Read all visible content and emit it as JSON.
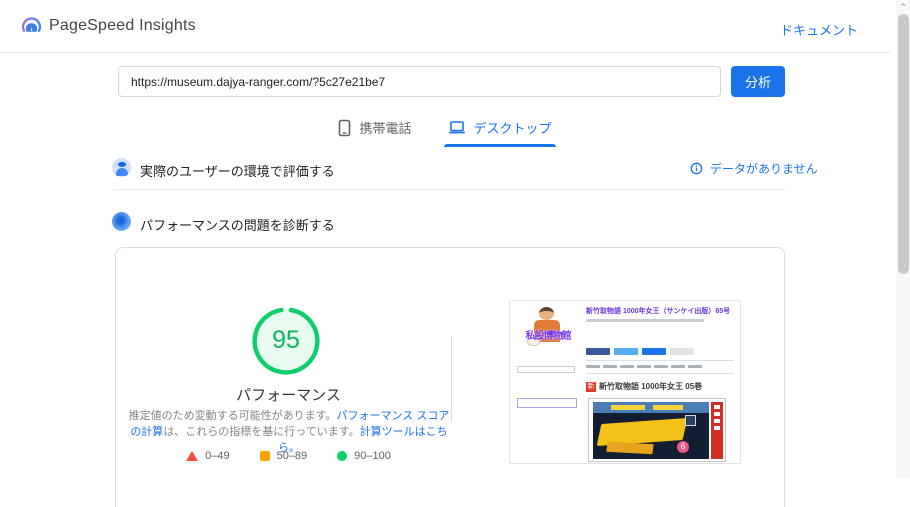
{
  "header": {
    "title": "PageSpeed Insights",
    "doc_link": "ドキュメント"
  },
  "url_bar": {
    "value": "https://museum.dajya-ranger.com/?5c27e21be7",
    "analyze_button": "分析"
  },
  "tabs": [
    {
      "label": "携帯電話",
      "icon": "mobile-phone-icon",
      "active": false
    },
    {
      "label": "デスクトップ",
      "icon": "laptop-icon",
      "active": true
    }
  ],
  "sections": {
    "field_data": {
      "icon": "users-icon",
      "title": "実際のユーザーの環境で評価する",
      "status_icon": "info-icon",
      "status": "データがありません"
    },
    "diagnose": {
      "icon": "speedometer-icon",
      "title": "パフォーマンスの問題を診断する"
    }
  },
  "report": {
    "score": "95",
    "score_label": "パフォーマンス",
    "note_text_1": "推定値のため変動する可能性があります。",
    "note_link_1": "パフォーマンス スコアの計算",
    "note_text_2": "は、これらの指標を基に行っています。",
    "note_link_2": "計算ツールはこちら。",
    "legend": [
      {
        "shape": "triangle",
        "color": "#ff4e42",
        "range": "0–49"
      },
      {
        "shape": "square",
        "color": "#ffa400",
        "range": "50–89"
      },
      {
        "shape": "circle",
        "color": "#0cce6b",
        "range": "90–100"
      }
    ]
  },
  "thumbnail": {
    "site_title": "私設博物館",
    "post_title": "新竹取物語 1000年女王（サンケイ出版）65号",
    "post_heading": "新竹取物語 1000年女王 05巻",
    "cover_badge": "6",
    "new_badge": "新"
  },
  "scrollbar": {
    "up_arrow": "⌃"
  },
  "colors": {
    "accent_blue": "#1a73e8",
    "score_green": "#0cce6b",
    "legend_orange": "#ffa400",
    "legend_red": "#ff4e42",
    "text_primary": "#202124",
    "text_secondary": "#5f6368"
  }
}
